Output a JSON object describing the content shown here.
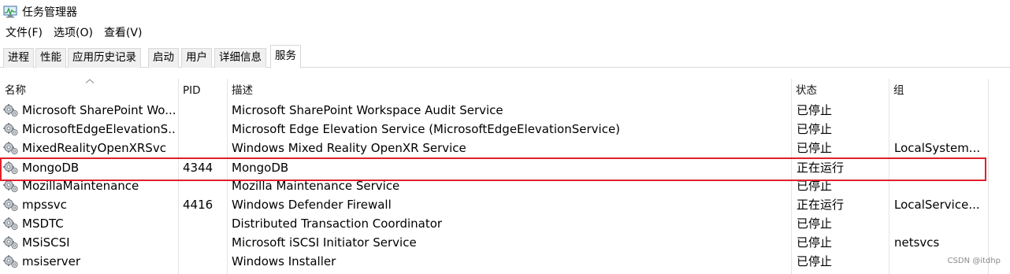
{
  "window": {
    "title": "任务管理器",
    "app_icon": "task-manager-icon"
  },
  "menubar": {
    "items": [
      "文件(F)",
      "选项(O)",
      "查看(V)"
    ]
  },
  "tabs": [
    "进程",
    "性能",
    "应用历史记录",
    "启动",
    "用户",
    "详细信息",
    "服务"
  ],
  "active_tab": "服务",
  "table": {
    "sort_column": "名称",
    "sort_direction": "ascending",
    "columns": [
      "名称",
      "PID",
      "描述",
      "状态",
      "组"
    ],
    "rows": [
      {
        "name": "Microsoft SharePoint Wo...",
        "pid": "",
        "description": "Microsoft SharePoint Workspace Audit Service",
        "status": "已停止",
        "group": ""
      },
      {
        "name": "MicrosoftEdgeElevationS...",
        "pid": "",
        "description": "Microsoft Edge Elevation Service (MicrosoftEdgeElevationService)",
        "status": "已停止",
        "group": ""
      },
      {
        "name": "MixedRealityOpenXRSvc",
        "pid": "",
        "description": "Windows Mixed Reality OpenXR Service",
        "status": "已停止",
        "group": "LocalSystem..."
      },
      {
        "name": "MongoDB",
        "pid": "4344",
        "description": "MongoDB",
        "status": "正在运行",
        "group": ""
      },
      {
        "name": "MozillaMaintenance",
        "pid": "",
        "description": "Mozilla Maintenance Service",
        "status": "已停止",
        "group": ""
      },
      {
        "name": "mpssvc",
        "pid": "4416",
        "description": "Windows Defender Firewall",
        "status": "正在运行",
        "group": "LocalService..."
      },
      {
        "name": "MSDTC",
        "pid": "",
        "description": "Distributed Transaction Coordinator",
        "status": "已停止",
        "group": ""
      },
      {
        "name": "MSiSCSI",
        "pid": "",
        "description": "Microsoft iSCSI Initiator Service",
        "status": "已停止",
        "group": "netsvcs"
      },
      {
        "name": "msiserver",
        "pid": "",
        "description": "Windows Installer",
        "status": "已停止",
        "group": ""
      }
    ],
    "row_icon": "service-gears-icon"
  },
  "annotation": {
    "highlighted_row": "MongoDB",
    "color": "#e0202a"
  },
  "watermark": "CSDN @itdhp"
}
